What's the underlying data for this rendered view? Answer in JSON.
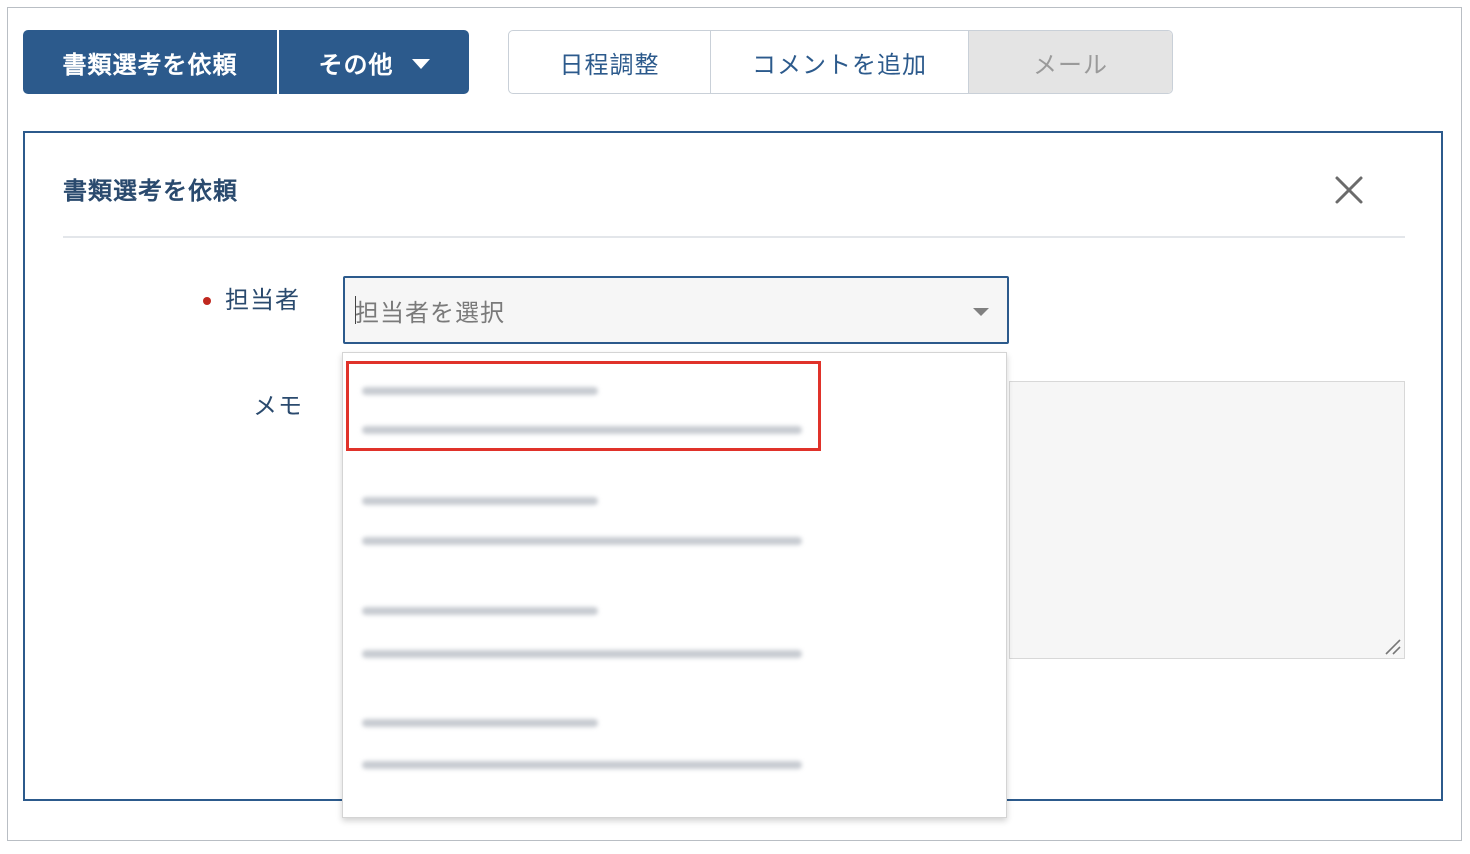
{
  "toolbar": {
    "request_screening_label": "書類選考を依頼",
    "more_label": "その他",
    "schedule_label": "日程調整",
    "add_comment_label": "コメントを追加",
    "mail_label": "メール"
  },
  "panel": {
    "title": "書類選考を依頼",
    "assignee_label": "担当者",
    "assignee_placeholder": "担当者を選択",
    "memo_label": "メモ"
  },
  "colors": {
    "primary": "#2c5a8c",
    "required": "#c0281f",
    "highlight": "#e0322a"
  }
}
